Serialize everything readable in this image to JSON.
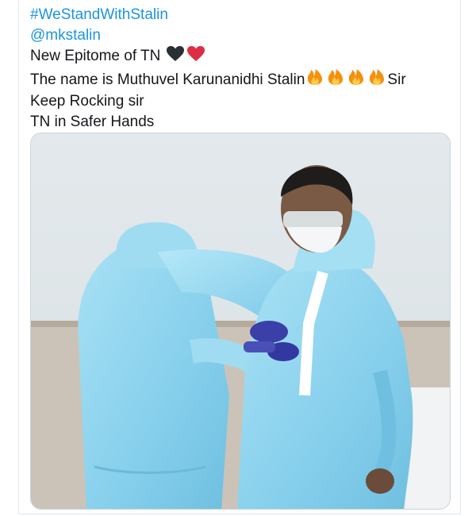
{
  "tweet": {
    "hashtag": "#WeStandWithStalin",
    "mention": "@mkstalin",
    "line1": "New Epitome of TN",
    "line1_emojis": [
      "black-heart-icon",
      "red-heart-icon"
    ],
    "line2_prefix": "The name is Muthuvel Karunanidhi Stalin",
    "line2_emojis": [
      "fire-icon",
      "fire-icon",
      "fire-icon",
      "fire-icon"
    ],
    "line2_suffix": "Sir",
    "line3": "Keep Rocking sir",
    "line4": "TN in Safer Hands"
  },
  "colors": {
    "link": "#1b95e0",
    "text": "#14171a",
    "ppe": "#8fd3ee",
    "glove": "#3b3fa8"
  },
  "media": {
    "icon": "photo-two-people-in-ppe-kits"
  }
}
